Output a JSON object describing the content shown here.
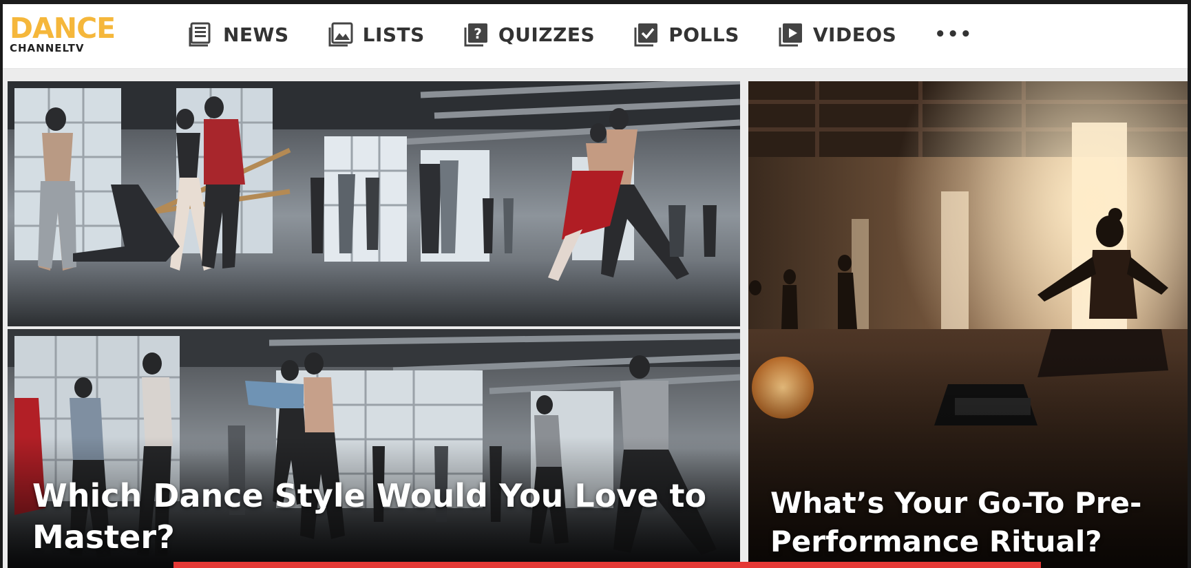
{
  "brand": {
    "logo_primary": "DANCE",
    "logo_secondary": "CHANNELTV",
    "accent_color": "#f5b73b"
  },
  "nav": {
    "items": [
      {
        "label": "NEWS",
        "icon": "news-icon"
      },
      {
        "label": "LISTS",
        "icon": "image-icon"
      },
      {
        "label": "QUIZZES",
        "icon": "question-icon"
      },
      {
        "label": "POLLS",
        "icon": "checkbox-icon"
      },
      {
        "label": "VIDEOS",
        "icon": "play-icon"
      }
    ],
    "more_label": "•••"
  },
  "cards": [
    {
      "title": "",
      "image": "dance-studio-ballet-partners"
    },
    {
      "title": "Which Dance Style Would You Love to Master?",
      "image": "dance-studio-group-class"
    },
    {
      "title": "What’s Your Go-To Pre-Performance Ritual?",
      "image": "studio-meditation-warm-light"
    }
  ],
  "progress_color": "#e53935"
}
